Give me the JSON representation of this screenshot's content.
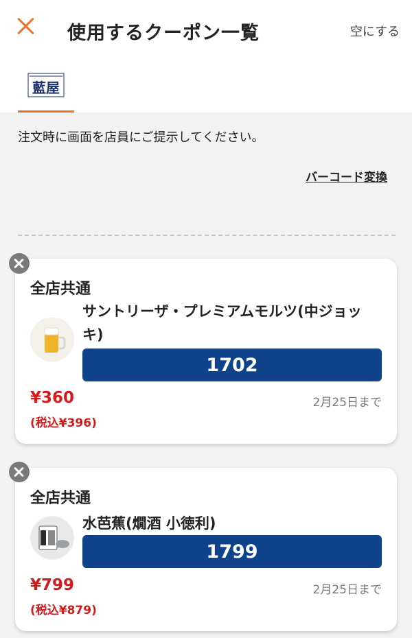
{
  "header": {
    "title": "使用するクーポン一覧",
    "clear_label": "空にする",
    "close_icon": "close-icon",
    "accent_color": "#e8742a"
  },
  "tabs": [
    {
      "logo_text": "藍屋",
      "selected": true
    }
  ],
  "instruction": "注文時に画面を店員にご提示してください。",
  "barcode_link": "バーコード変換",
  "coupons": [
    {
      "store": "全店共通",
      "name": "サントリーザ・プレミアムモルツ(中ジョッキ)",
      "code": "1702",
      "price": "¥360",
      "price_with_tax": "(税込¥396)",
      "expiry": "2月25日まで"
    },
    {
      "store": "全店共通",
      "name": "水芭蕉(燗酒 小徳利)",
      "code": "1799",
      "price": "¥799",
      "price_with_tax": "(税込¥879)",
      "expiry": "2月25日まで"
    }
  ],
  "colors": {
    "code_bar": "#0f4389",
    "price": "#d01c1c",
    "background": "#f2f2f2"
  }
}
